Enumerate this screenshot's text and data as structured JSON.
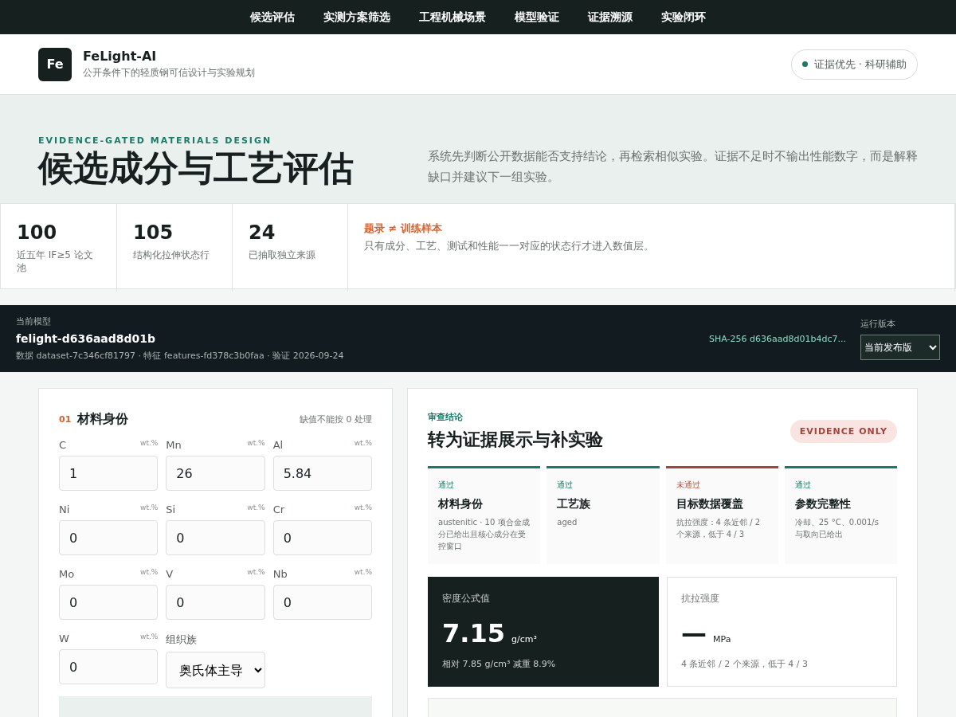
{
  "nav": [
    {
      "label": "候选评估"
    },
    {
      "label": "实测方案筛选"
    },
    {
      "label": "工程机械场景"
    },
    {
      "label": "模型验证"
    },
    {
      "label": "证据溯源"
    },
    {
      "label": "实验闭环"
    }
  ],
  "brand": {
    "logo": "Fe",
    "name": "FeLight-AI",
    "tagline": "公开条件下的轻质钢可信设计与实验规划"
  },
  "badge": {
    "text": "证据优先 · 科研辅助"
  },
  "hero": {
    "eyebrow": "EVIDENCE-GATED MATERIALS DESIGN",
    "title": "候选成分与工艺评估",
    "intro": "系统先判断公开数据能否支持结论，再检索相似实验。证据不足时不输出性能数字，而是解释缺口并建议下一组实验。"
  },
  "stats": [
    {
      "value": "100",
      "label": "近五年 IF≥5 论文池"
    },
    {
      "value": "105",
      "label": "结构化拉伸状态行"
    },
    {
      "value": "24",
      "label": "已抽取独立来源"
    }
  ],
  "note": {
    "title": "题录 ≠ 训练样本",
    "text": "只有成分、工艺、测试和性能一一对应的状态行才进入数值层。"
  },
  "model": {
    "label": "当前模型",
    "name": "felight-d636aad8d01b",
    "meta": "数据 dataset-7c346cf81797 · 特征 features-fd378c3b0faa · 验证 2026-09-24",
    "hash": "SHA-256 d636aad8d01b4dc7...",
    "version_label": "运行版本",
    "version": "当前发布版"
  },
  "identity": {
    "index": "01",
    "title": "材料身份",
    "hint": "缺值不能按 0 处理",
    "elements": [
      {
        "symbol": "C",
        "unit": "wt.%",
        "value": "1"
      },
      {
        "symbol": "Mn",
        "unit": "wt.%",
        "value": "26"
      },
      {
        "symbol": "Al",
        "unit": "wt.%",
        "value": "5.84"
      },
      {
        "symbol": "Ni",
        "unit": "wt.%",
        "value": "0"
      },
      {
        "symbol": "Si",
        "unit": "wt.%",
        "value": "0"
      },
      {
        "symbol": "Cr",
        "unit": "wt.%",
        "value": "0"
      },
      {
        "symbol": "Mo",
        "unit": "wt.%",
        "value": "0"
      },
      {
        "symbol": "V",
        "unit": "wt.%",
        "value": "0"
      },
      {
        "symbol": "Nb",
        "unit": "wt.%",
        "value": "0"
      },
      {
        "symbol": "W",
        "unit": "wt.%",
        "value": "0"
      }
    ],
    "structure_label": "组织族",
    "structure": "奥氏体主导"
  },
  "review": {
    "eyebrow": "审查结论",
    "title": "转为证据展示与补实验",
    "status": "EVIDENCE ONLY",
    "checks": [
      {
        "status": "通过",
        "passed": true,
        "title": "材料身份",
        "detail": "austenitic · 10 项合金成分已给出且核心成分在受控窗口"
      },
      {
        "status": "通过",
        "passed": true,
        "title": "工艺族",
        "detail": "aged"
      },
      {
        "status": "未通过",
        "passed": false,
        "title": "目标数据覆盖",
        "detail": "抗拉强度：4 条近邻 / 2 个来源，低于 4 / 3"
      },
      {
        "status": "通过",
        "passed": true,
        "title": "参数完整性",
        "detail": "冷却、25 °C、0.001/s 与取向已给出"
      }
    ],
    "metrics": [
      {
        "kind": "dark",
        "label": "密度公式值",
        "value": "7.15",
        "unit": "g/cm³",
        "note": "相对 7.85 g/cm³ 减重 8.9%"
      },
      {
        "kind": "light",
        "label": "抗拉强度",
        "value": "—",
        "unit": "MPa",
        "note": "4 条近邻 / 2 个来源，低于 4 / 3"
      }
    ]
  }
}
